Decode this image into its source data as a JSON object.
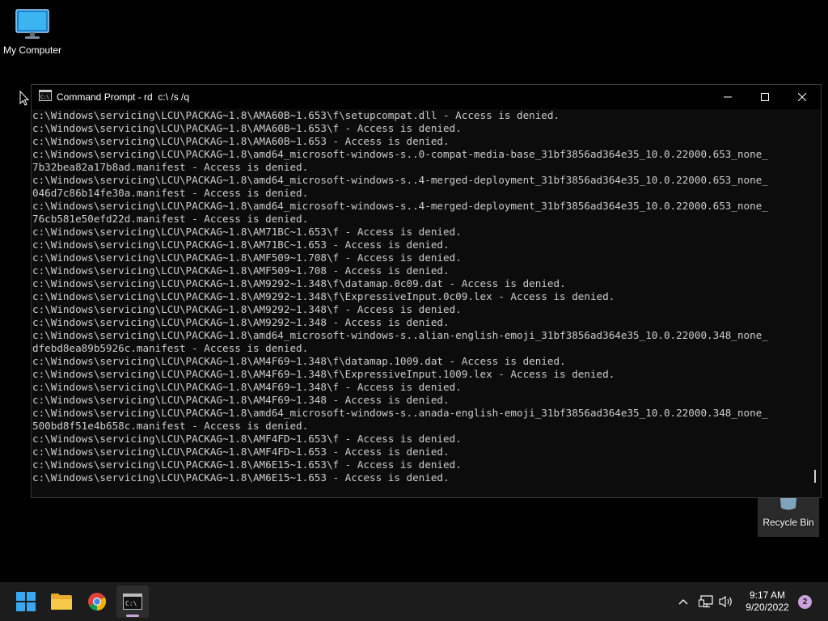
{
  "desktop": {
    "my_computer_label": "My Computer",
    "recycle_bin_label": "Recycle Bin"
  },
  "window": {
    "title": "Command Prompt - rd  c:\\ /s /q",
    "icons": {
      "app": "cmd-icon",
      "minimize": "minimize-icon",
      "maximize": "maximize-icon",
      "close": "close-icon"
    }
  },
  "console": {
    "lines": [
      "c:\\Windows\\servicing\\LCU\\PACKAG~1.8\\AMA60B~1.653\\f\\setupcompat.dll - Access is denied.",
      "c:\\Windows\\servicing\\LCU\\PACKAG~1.8\\AMA60B~1.653\\f - Access is denied.",
      "c:\\Windows\\servicing\\LCU\\PACKAG~1.8\\AMA60B~1.653 - Access is denied.",
      "c:\\Windows\\servicing\\LCU\\PACKAG~1.8\\amd64_microsoft-windows-s..0-compat-media-base_31bf3856ad364e35_10.0.22000.653_none_",
      "7b32bea82a17b8ad.manifest - Access is denied.",
      "c:\\Windows\\servicing\\LCU\\PACKAG~1.8\\amd64_microsoft-windows-s..4-merged-deployment_31bf3856ad364e35_10.0.22000.653_none_",
      "046d7c86b14fe30a.manifest - Access is denied.",
      "c:\\Windows\\servicing\\LCU\\PACKAG~1.8\\amd64_microsoft-windows-s..4-merged-deployment_31bf3856ad364e35_10.0.22000.653_none_",
      "76cb581e50efd22d.manifest - Access is denied.",
      "c:\\Windows\\servicing\\LCU\\PACKAG~1.8\\AM71BC~1.653\\f - Access is denied.",
      "c:\\Windows\\servicing\\LCU\\PACKAG~1.8\\AM71BC~1.653 - Access is denied.",
      "c:\\Windows\\servicing\\LCU\\PACKAG~1.8\\AMF509~1.708\\f - Access is denied.",
      "c:\\Windows\\servicing\\LCU\\PACKAG~1.8\\AMF509~1.708 - Access is denied.",
      "c:\\Windows\\servicing\\LCU\\PACKAG~1.8\\AM9292~1.348\\f\\datamap.0c09.dat - Access is denied.",
      "c:\\Windows\\servicing\\LCU\\PACKAG~1.8\\AM9292~1.348\\f\\ExpressiveInput.0c09.lex - Access is denied.",
      "c:\\Windows\\servicing\\LCU\\PACKAG~1.8\\AM9292~1.348\\f - Access is denied.",
      "c:\\Windows\\servicing\\LCU\\PACKAG~1.8\\AM9292~1.348 - Access is denied.",
      "c:\\Windows\\servicing\\LCU\\PACKAG~1.8\\amd64_microsoft-windows-s..alian-english-emoji_31bf3856ad364e35_10.0.22000.348_none_",
      "dfebd8ea89b5926c.manifest - Access is denied.",
      "c:\\Windows\\servicing\\LCU\\PACKAG~1.8\\AM4F69~1.348\\f\\datamap.1009.dat - Access is denied.",
      "c:\\Windows\\servicing\\LCU\\PACKAG~1.8\\AM4F69~1.348\\f\\ExpressiveInput.1009.lex - Access is denied.",
      "c:\\Windows\\servicing\\LCU\\PACKAG~1.8\\AM4F69~1.348\\f - Access is denied.",
      "c:\\Windows\\servicing\\LCU\\PACKAG~1.8\\AM4F69~1.348 - Access is denied.",
      "c:\\Windows\\servicing\\LCU\\PACKAG~1.8\\amd64_microsoft-windows-s..anada-english-emoji_31bf3856ad364e35_10.0.22000.348_none_",
      "500bd8f51e4b658c.manifest - Access is denied.",
      "c:\\Windows\\servicing\\LCU\\PACKAG~1.8\\AMF4FD~1.653\\f - Access is denied.",
      "c:\\Windows\\servicing\\LCU\\PACKAG~1.8\\AMF4FD~1.653 - Access is denied.",
      "c:\\Windows\\servicing\\LCU\\PACKAG~1.8\\AM6E15~1.653\\f - Access is denied.",
      "c:\\Windows\\servicing\\LCU\\PACKAG~1.8\\AM6E15~1.653 - Access is denied."
    ]
  },
  "taskbar": {
    "items": [
      "windows-start-icon",
      "file-explorer-icon",
      "chrome-icon",
      "cmd-icon"
    ],
    "tray": [
      "chevron-up-icon",
      "network-icon",
      "volume-icon"
    ],
    "time": "9:17 AM",
    "date": "9/20/2022",
    "notification_count": "2"
  },
  "colors": {
    "console_bg": "#0c0c0c",
    "console_text": "#cccccc",
    "taskbar_bg": "#1c1c1c",
    "accent": "#c9a2d9"
  }
}
